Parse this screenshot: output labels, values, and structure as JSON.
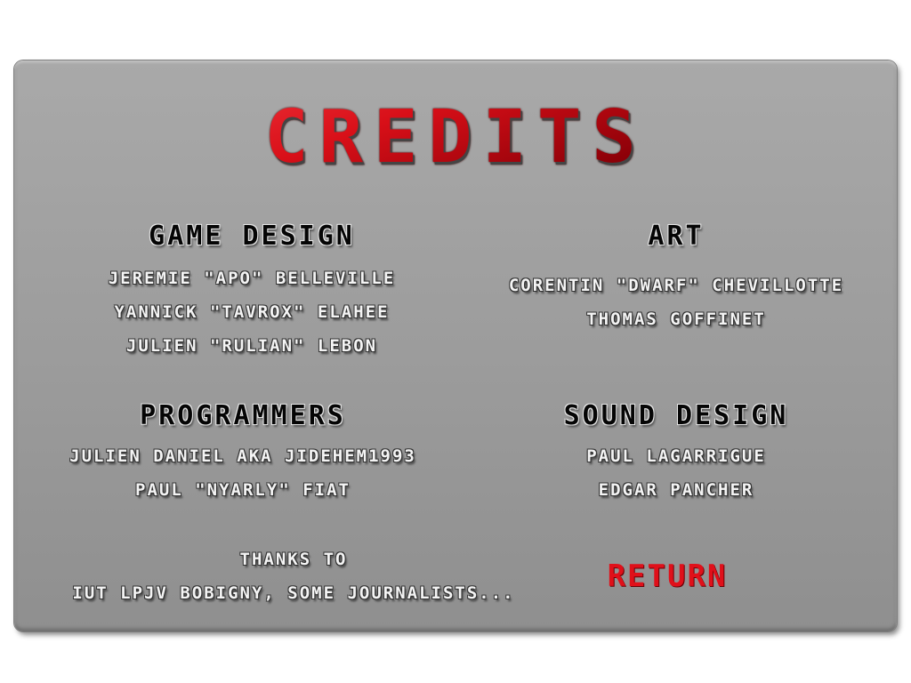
{
  "screen": {
    "title": "CREDITS",
    "title_color": "#d0101a",
    "panel_color": "#9e9e9e"
  },
  "sections": {
    "game_design": {
      "heading": "GAME DESIGN",
      "lines": [
        "JEREMIE \"APO\" BELLEVILLE",
        "YANNICK \"TAVROX\" ELAHEE",
        "JULIEN \"RULIAN\" LEBON"
      ]
    },
    "art": {
      "heading": "ART",
      "lines": [
        "CORENTIN \"DWARF\" CHEVILLOTTE",
        "THOMAS GOFFINET"
      ]
    },
    "programmers": {
      "heading": "PROGRAMMERS",
      "lines": [
        "JULIEN DANIEL AKA JIDEHEM1993",
        "PAUL \"NYARLY\" FIAT"
      ]
    },
    "sound_design": {
      "heading": "SOUND DESIGN",
      "lines": [
        "PAUL LAGARRIGUE",
        "EDGAR PANCHER"
      ]
    },
    "thanks": {
      "lines": [
        "THANKS TO",
        "IUT LPJV BOBIGNY, SOME JOURNALISTS..."
      ]
    }
  },
  "buttons": {
    "return_label": "RETURN",
    "return_color": "#e0101a"
  }
}
